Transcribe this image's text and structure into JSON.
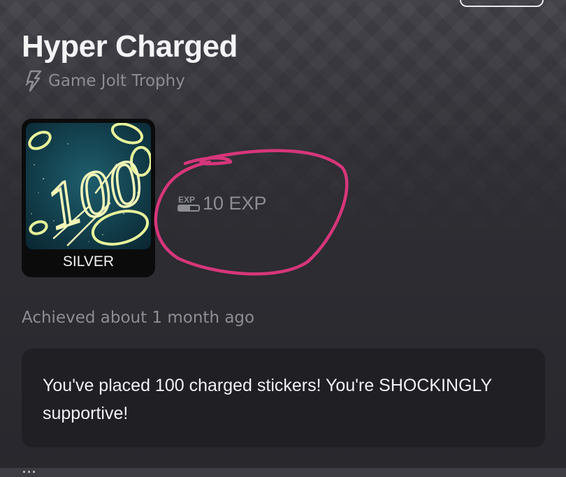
{
  "trophy": {
    "title": "Hyper Charged",
    "type_label": "Game Jolt Trophy",
    "tier": "SILVER",
    "image_text": "100",
    "exp": "10 EXP",
    "achieved": "Achieved about 1 month ago",
    "description": "You've placed 100 charged stickers! You're SHOCKINGLY supportive!"
  },
  "icons": {
    "type": "lightning-bolt-icon",
    "exp": "exp-icon"
  },
  "colors": {
    "annotation": "#d6367a",
    "glow": "#e8f29a"
  },
  "footer": {
    "partial_text": "..."
  }
}
